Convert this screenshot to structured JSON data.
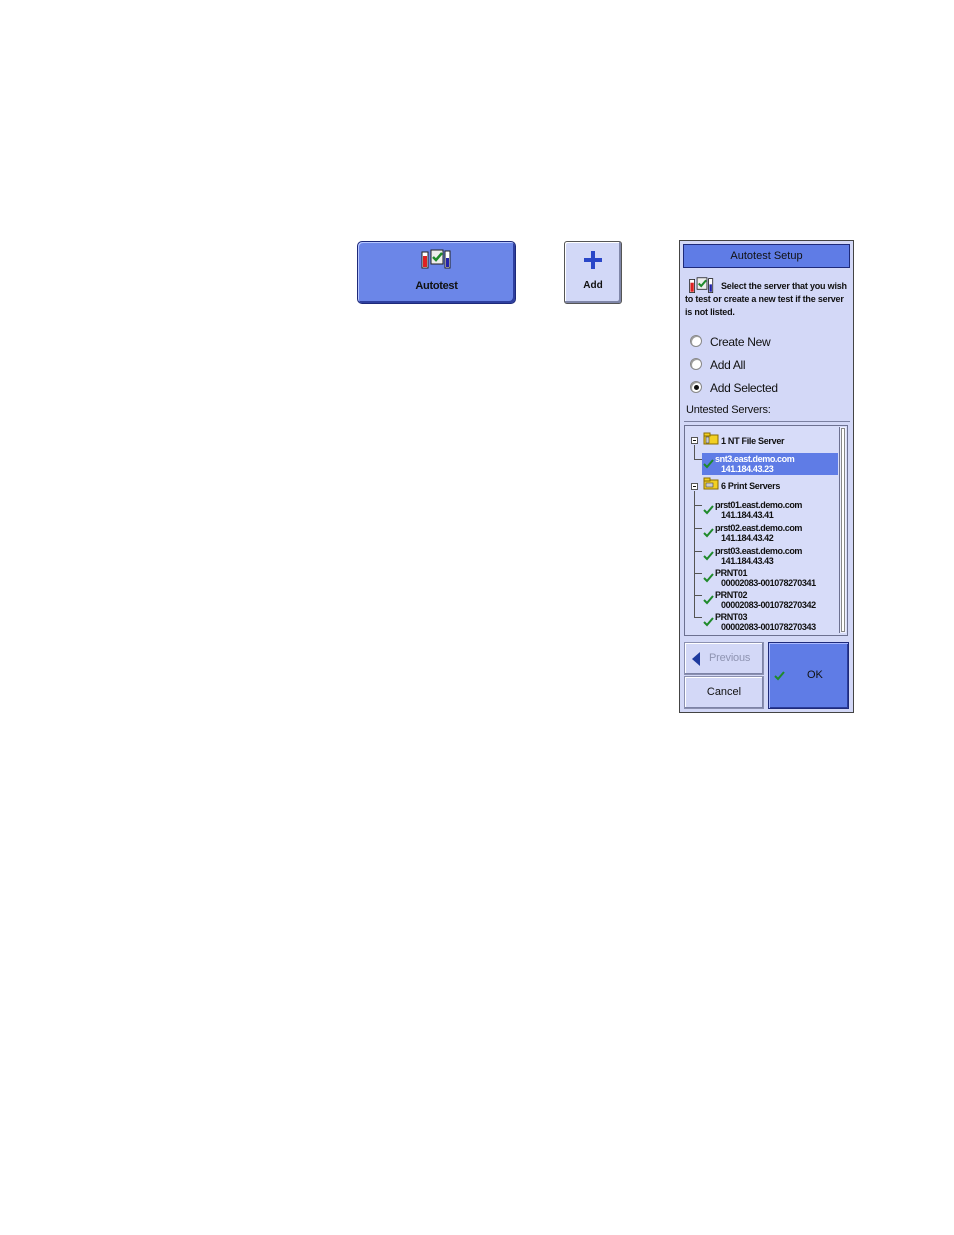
{
  "autotest_button": {
    "label": "Autotest",
    "icon": "autotest-icon"
  },
  "add_button": {
    "label": "Add",
    "icon": "plus-icon"
  },
  "dialog": {
    "title": "Autotest Setup",
    "prompt": "Select the server that you wish to test or create a new test if the server is not listed.",
    "options": [
      {
        "label": "Create New",
        "checked": false
      },
      {
        "label": "Add All",
        "checked": false
      },
      {
        "label": "Add Selected",
        "checked": true
      }
    ],
    "untested_label": "Untested Servers:",
    "tree": {
      "groups": [
        {
          "label": "1 NT File Server",
          "items": [
            {
              "line1": "snt3.east.demo.com",
              "line2": "141.184.43.23",
              "selected": true
            }
          ]
        },
        {
          "label": "6 Print Servers",
          "items": [
            {
              "line1": "prst01.east.demo.com",
              "line2": "141.184.43.41",
              "selected": false
            },
            {
              "line1": "prst02.east.demo.com",
              "line2": "141.184.43.42",
              "selected": false
            },
            {
              "line1": "prst03.east.demo.com",
              "line2": "141.184.43.43",
              "selected": false
            },
            {
              "line1": "PRNT01",
              "line2": "00002083-001078270341",
              "selected": false
            },
            {
              "line1": "PRNT02",
              "line2": "00002083-001078270342",
              "selected": false
            },
            {
              "line1": "PRNT03",
              "line2": "00002083-001078270343",
              "selected": false
            }
          ]
        }
      ]
    },
    "buttons": {
      "previous": "Previous",
      "cancel": "Cancel",
      "ok": "OK"
    },
    "colors": {
      "accent": "#5f7ce6",
      "panel": "#d3d8f7",
      "check": "#1f8a2b"
    }
  }
}
